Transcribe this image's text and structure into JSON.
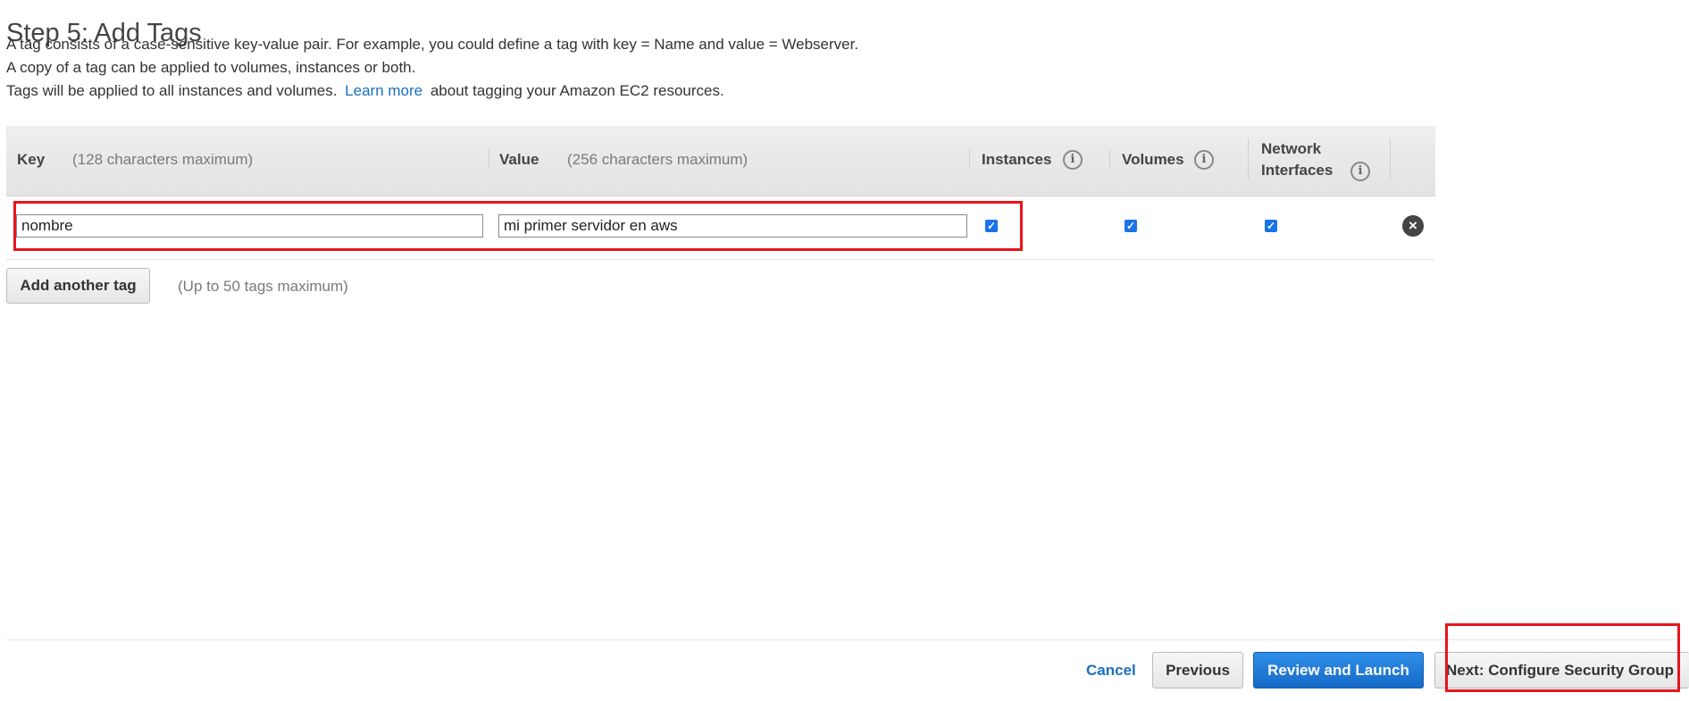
{
  "page": {
    "title": "Step 5: Add Tags",
    "desc_line1": "A tag consists of a case-sensitive key-value pair. For example, you could define a tag with key = Name and value = Webserver.",
    "desc_line2": "A copy of a tag can be applied to volumes, instances or both.",
    "desc_line3_pre": "Tags will be applied to all instances and volumes.",
    "desc_line3_link": "Learn more",
    "desc_line3_post": "about tagging your Amazon EC2 resources."
  },
  "table": {
    "headers": {
      "key_label": "Key",
      "key_hint": "(128 characters maximum)",
      "value_label": "Value",
      "value_hint": "(256 characters maximum)",
      "instances_label": "Instances",
      "volumes_label": "Volumes",
      "network_line1": "Network",
      "network_line2": "Interfaces"
    },
    "rows": [
      {
        "key": "nombre",
        "value": "mi primer servidor en aws",
        "instances": true,
        "volumes": true,
        "network_interfaces": true
      }
    ]
  },
  "add_tag": {
    "button_label": "Add another tag",
    "hint": "(Up to 50 tags maximum)"
  },
  "footer": {
    "cancel_label": "Cancel",
    "previous_label": "Previous",
    "review_label": "Review and Launch",
    "next_label": "Next: Configure Security Group"
  },
  "icons": {
    "info": "info-icon",
    "remove": "remove-circle-icon",
    "checkbox": "checkbox-checked-icon"
  },
  "colors": {
    "link": "#1a6fc2",
    "primary_button": "#1a73e8",
    "highlight": "#e8141b"
  }
}
